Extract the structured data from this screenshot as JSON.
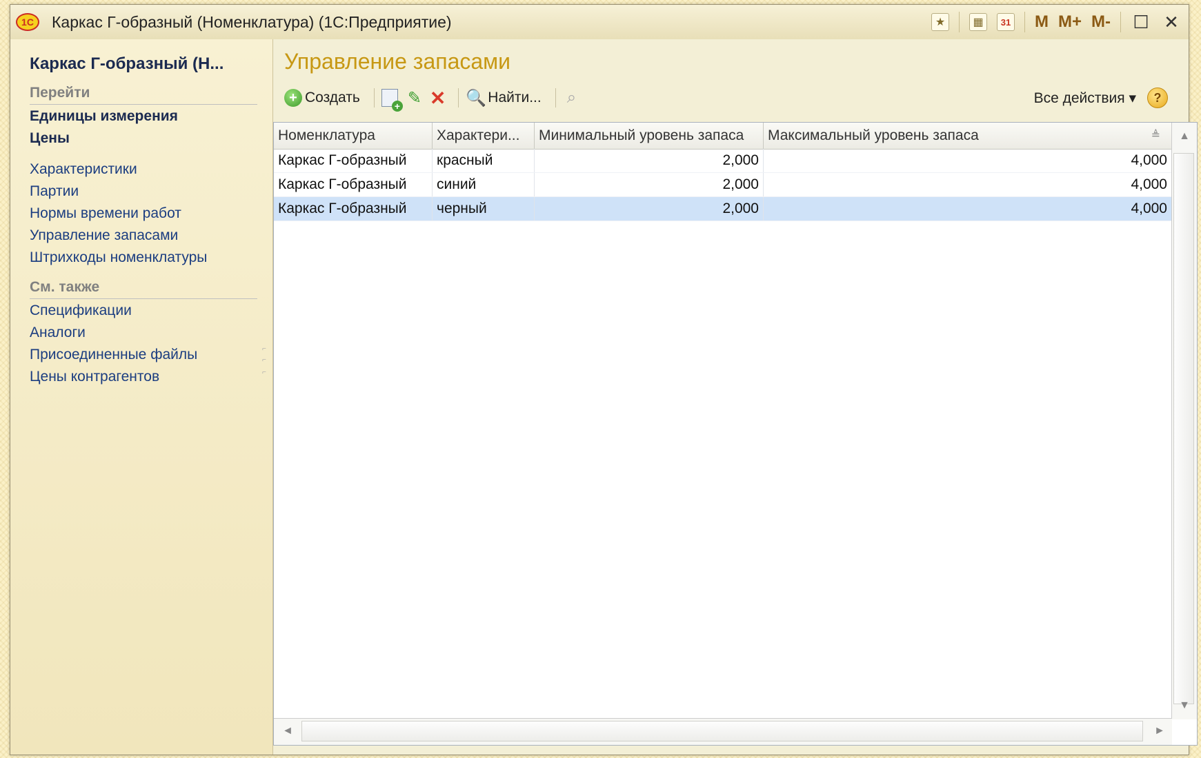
{
  "window": {
    "logo_text": "1С",
    "title": "Каркас Г-образный (Номенклатура)  (1С:Предприятие)",
    "calendar_day": "31",
    "m_label": "M",
    "mplus_label": "M+",
    "mminus_label": "M-"
  },
  "sidebar": {
    "heading": "Каркас Г-образный (Н...",
    "goto_label": "Перейти",
    "bold_items": [
      "Единицы измерения",
      "Цены"
    ],
    "links": [
      "Характеристики",
      "Партии",
      "Нормы времени работ",
      "Управление запасами",
      "Штрихкоды номенклатуры"
    ],
    "see_also_label": "См. также",
    "see_also_links": [
      "Спецификации",
      "Аналоги",
      "Присоединенные файлы",
      "Цены контрагентов"
    ]
  },
  "form": {
    "title": "Управление запасами",
    "toolbar": {
      "create_label": "Создать",
      "find_label": "Найти...",
      "all_actions_label": "Все действия ▾",
      "help_label": "?"
    }
  },
  "table": {
    "columns": [
      "Номенклатура",
      "Характери...",
      "Минимальный уровень запаса",
      "Максимальный уровень запаса"
    ],
    "rows": [
      [
        "Каркас Г-образный",
        "красный",
        "2,000",
        "4,000"
      ],
      [
        "Каркас Г-образный",
        "синий",
        "2,000",
        "4,000"
      ],
      [
        "Каркас Г-образный",
        "черный",
        "2,000",
        "4,000"
      ]
    ],
    "selected_row_index": 2
  },
  "colors": {
    "title_accent": "#c79814",
    "selection": "#cfe2f8",
    "background": "#f3efd6"
  }
}
